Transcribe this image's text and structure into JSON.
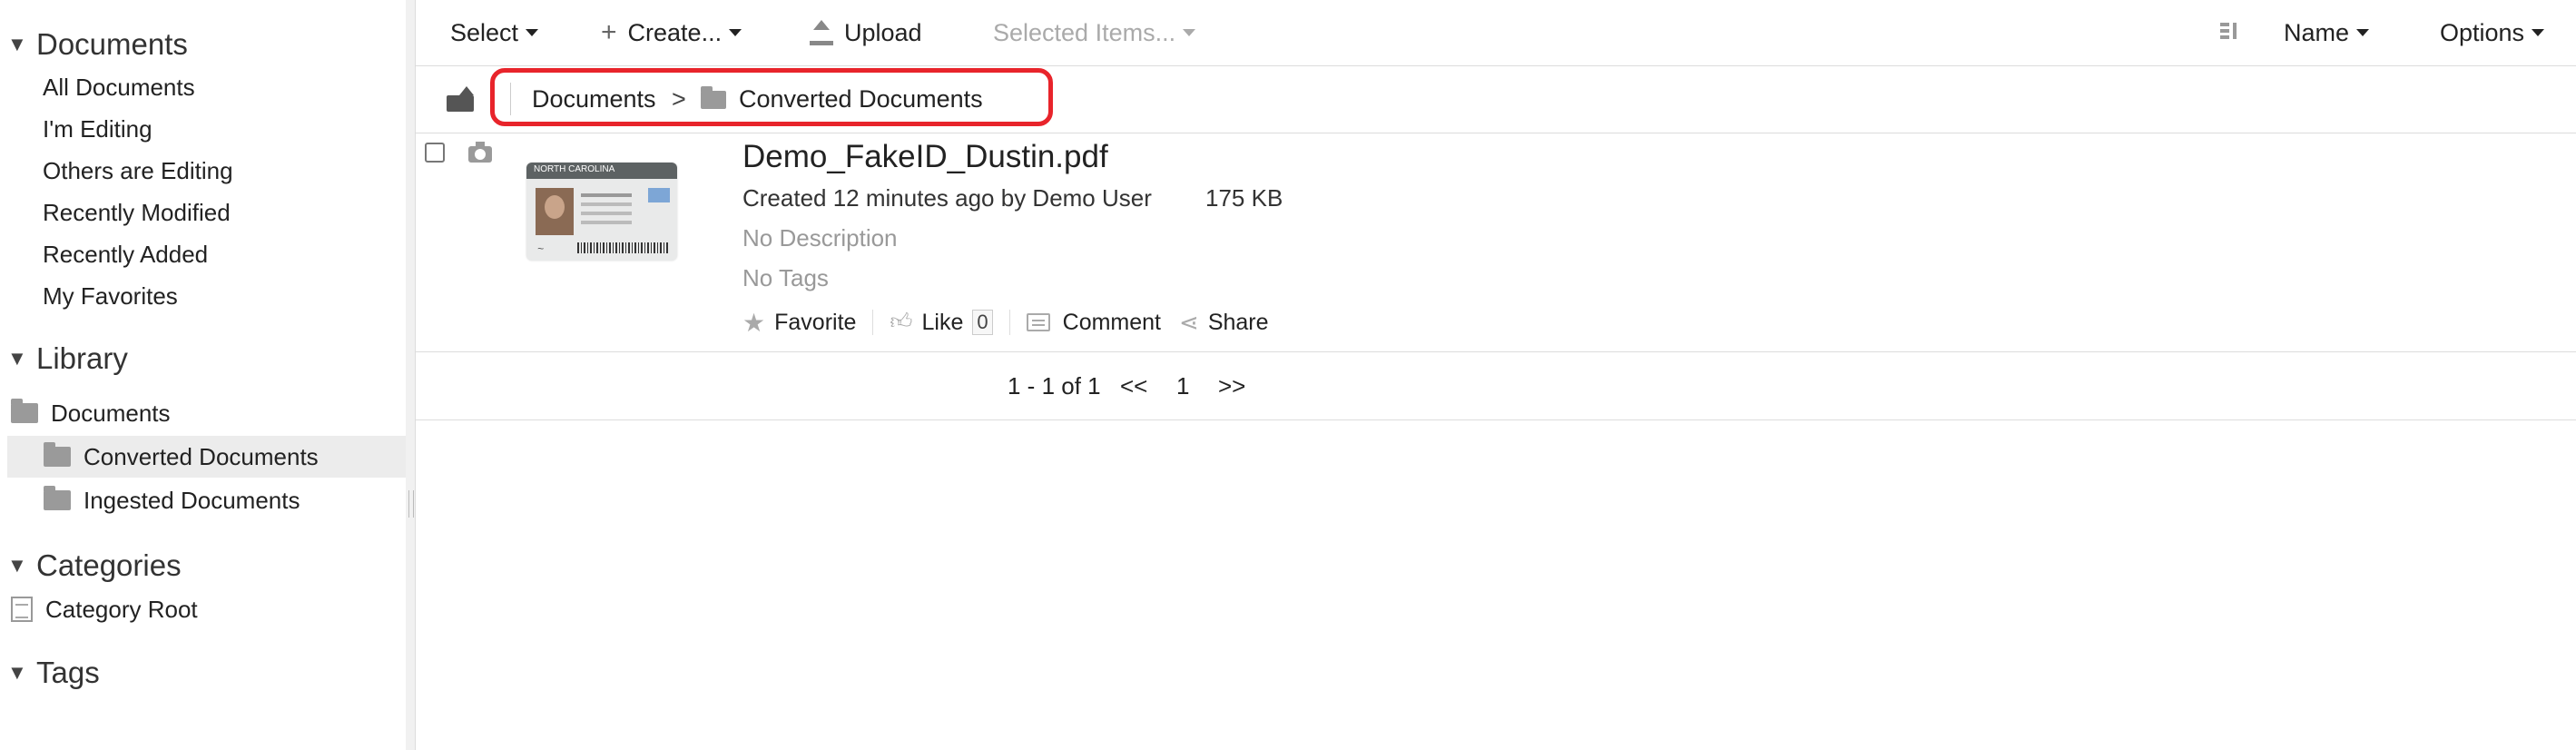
{
  "sidebar": {
    "documents": {
      "heading": "Documents",
      "items": [
        "All Documents",
        "I'm Editing",
        "Others are Editing",
        "Recently Modified",
        "Recently Added",
        "My Favorites"
      ]
    },
    "library": {
      "heading": "Library",
      "root": "Documents",
      "children": [
        "Converted Documents",
        "Ingested Documents"
      ],
      "selected": "Converted Documents"
    },
    "categories": {
      "heading": "Categories",
      "root": "Category Root"
    },
    "tags": {
      "heading": "Tags"
    }
  },
  "toolbar": {
    "select": "Select",
    "create": "Create...",
    "upload": "Upload",
    "selected_items": "Selected Items...",
    "sort_field": "Name",
    "options": "Options"
  },
  "breadcrumb": {
    "items": [
      "Documents",
      "Converted Documents"
    ],
    "separator": ">",
    "highlight_color": "#e8242b"
  },
  "document": {
    "title": "Demo_FakeID_Dustin.pdf",
    "meta": "Created 12 minutes ago by Demo User",
    "size": "175 KB",
    "description": "No Description",
    "tags": "No Tags",
    "thumbnail_header": "NORTH CAROLINA",
    "actions": {
      "favorite": "Favorite",
      "like": "Like",
      "like_count": "0",
      "comment": "Comment",
      "share": "Share"
    }
  },
  "pagination": {
    "range": "1 - 1 of 1",
    "prev": "<<",
    "page": "1",
    "next": ">>"
  }
}
